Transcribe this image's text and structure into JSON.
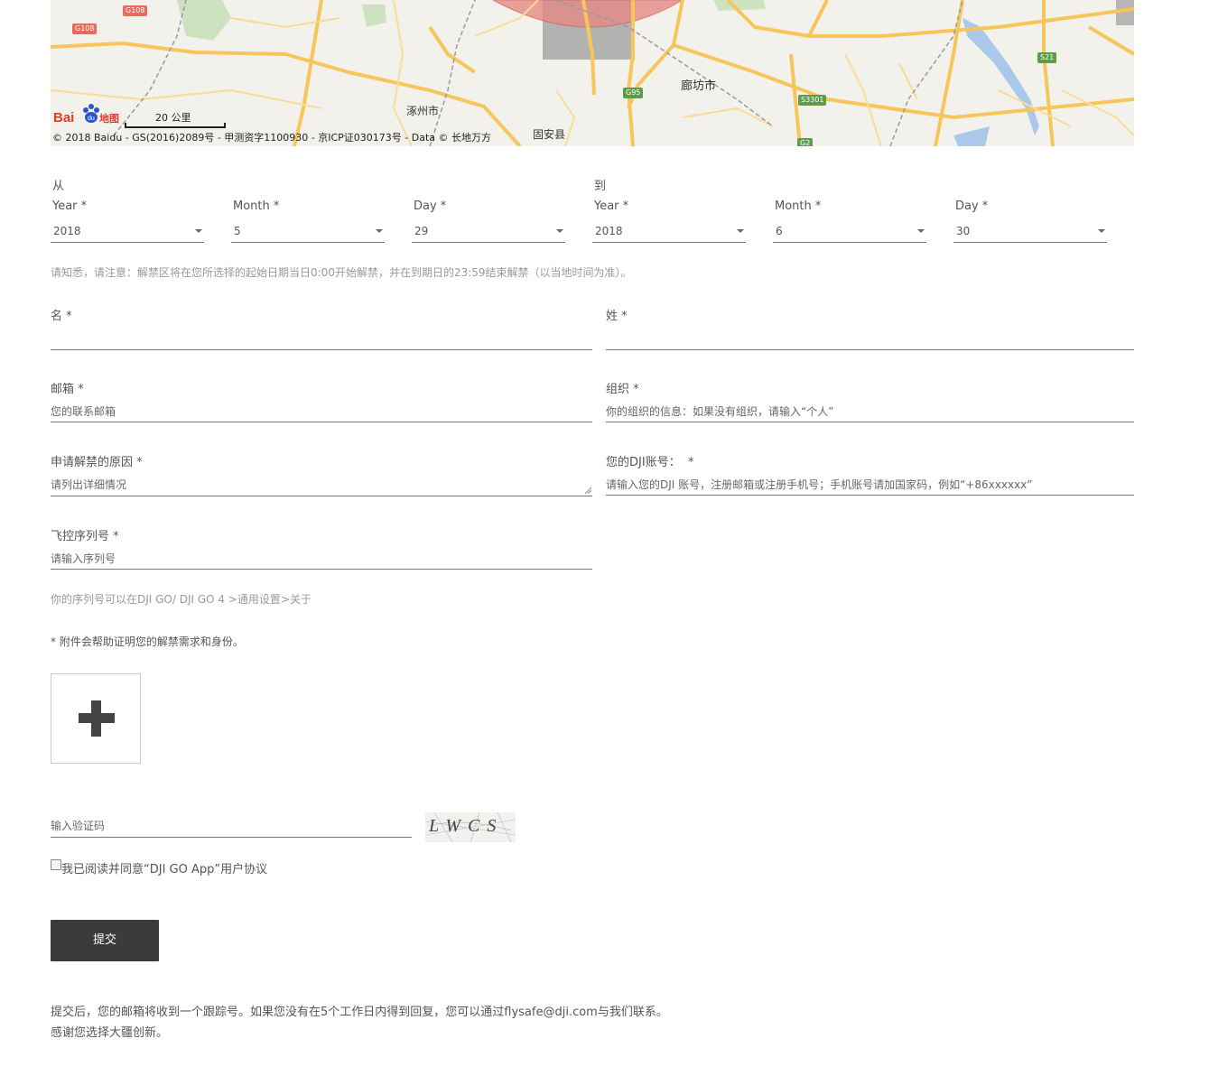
{
  "map": {
    "labels": {
      "langfang": "廊坊市",
      "zhuozhou": "涿州市",
      "guan": "固安县"
    },
    "shields": {
      "g108_a": "G108",
      "g108_b": "G108",
      "g95": "G95",
      "s3301": "S3301",
      "s21": "S21",
      "g2": "G2"
    },
    "scale": "20 公里",
    "logo": "Bai地图",
    "copyright": "© 2018 Baidu - GS(2016)2089号 - 甲测资字1100930 - 京ICP证030173号 - Data © 长地万方"
  },
  "date_range": {
    "from_label": "从",
    "to_label": "到",
    "from": {
      "year_label": "Year *",
      "year_value": "2018",
      "month_label": "Month *",
      "month_value": "5",
      "day_label": "Day *",
      "day_value": "29"
    },
    "to": {
      "year_label": "Year *",
      "year_value": "2018",
      "month_label": "Month *",
      "month_value": "6",
      "day_label": "Day *",
      "day_value": "30"
    },
    "notice": "请知悉，请注意：解禁区将在您所选择的起始日期当日0:00开始解禁，并在到期日的23:59结束解禁（以当地时间为准）。"
  },
  "form": {
    "first_name_label": "名 *",
    "last_name_label": "姓 *",
    "email_label": "邮箱 *",
    "email_placeholder": "您的联系邮箱",
    "org_label": "组织 *",
    "org_placeholder": "你的组织的信息：如果没有组织，请输入“个人”",
    "reason_label": "申请解禁的原因 *",
    "reason_placeholder": "请列出详细情况",
    "account_label": "您的DJI账号：  *",
    "account_placeholder": "请输入您的DJI 账号，注册邮箱或注册手机号；手机账号请加国家码，例如“+86xxxxxx”",
    "serial_label": "飞控序列号 *",
    "serial_placeholder": "请输入序列号",
    "serial_hint": "你的序列号可以在DJI GO/ DJI GO 4 >通用设置>关于",
    "attachment_note": "* 附件会帮助证明您的解禁需求和身份。",
    "captcha_placeholder": "输入验证码",
    "captcha_text": "LWCS",
    "agree_label": "我已阅读并同意“DJI GO App”用户协议",
    "submit_label": "提交",
    "footer_line1": "提交后，您的邮箱将收到一个跟踪号。如果您没有在5个工作日内得到回复，您可以通过flysafe@dji.com与我们联系。",
    "footer_line2": "感谢您选择大疆创新。"
  },
  "icons": {
    "upload": "plus-icon",
    "select_caret": "caret-down-icon"
  },
  "colors": {
    "submit_bg": "#3a3b3c",
    "map_bg": "#f3f1ec",
    "road": "#f7c65a",
    "nofly_zone": "#e58b86"
  }
}
